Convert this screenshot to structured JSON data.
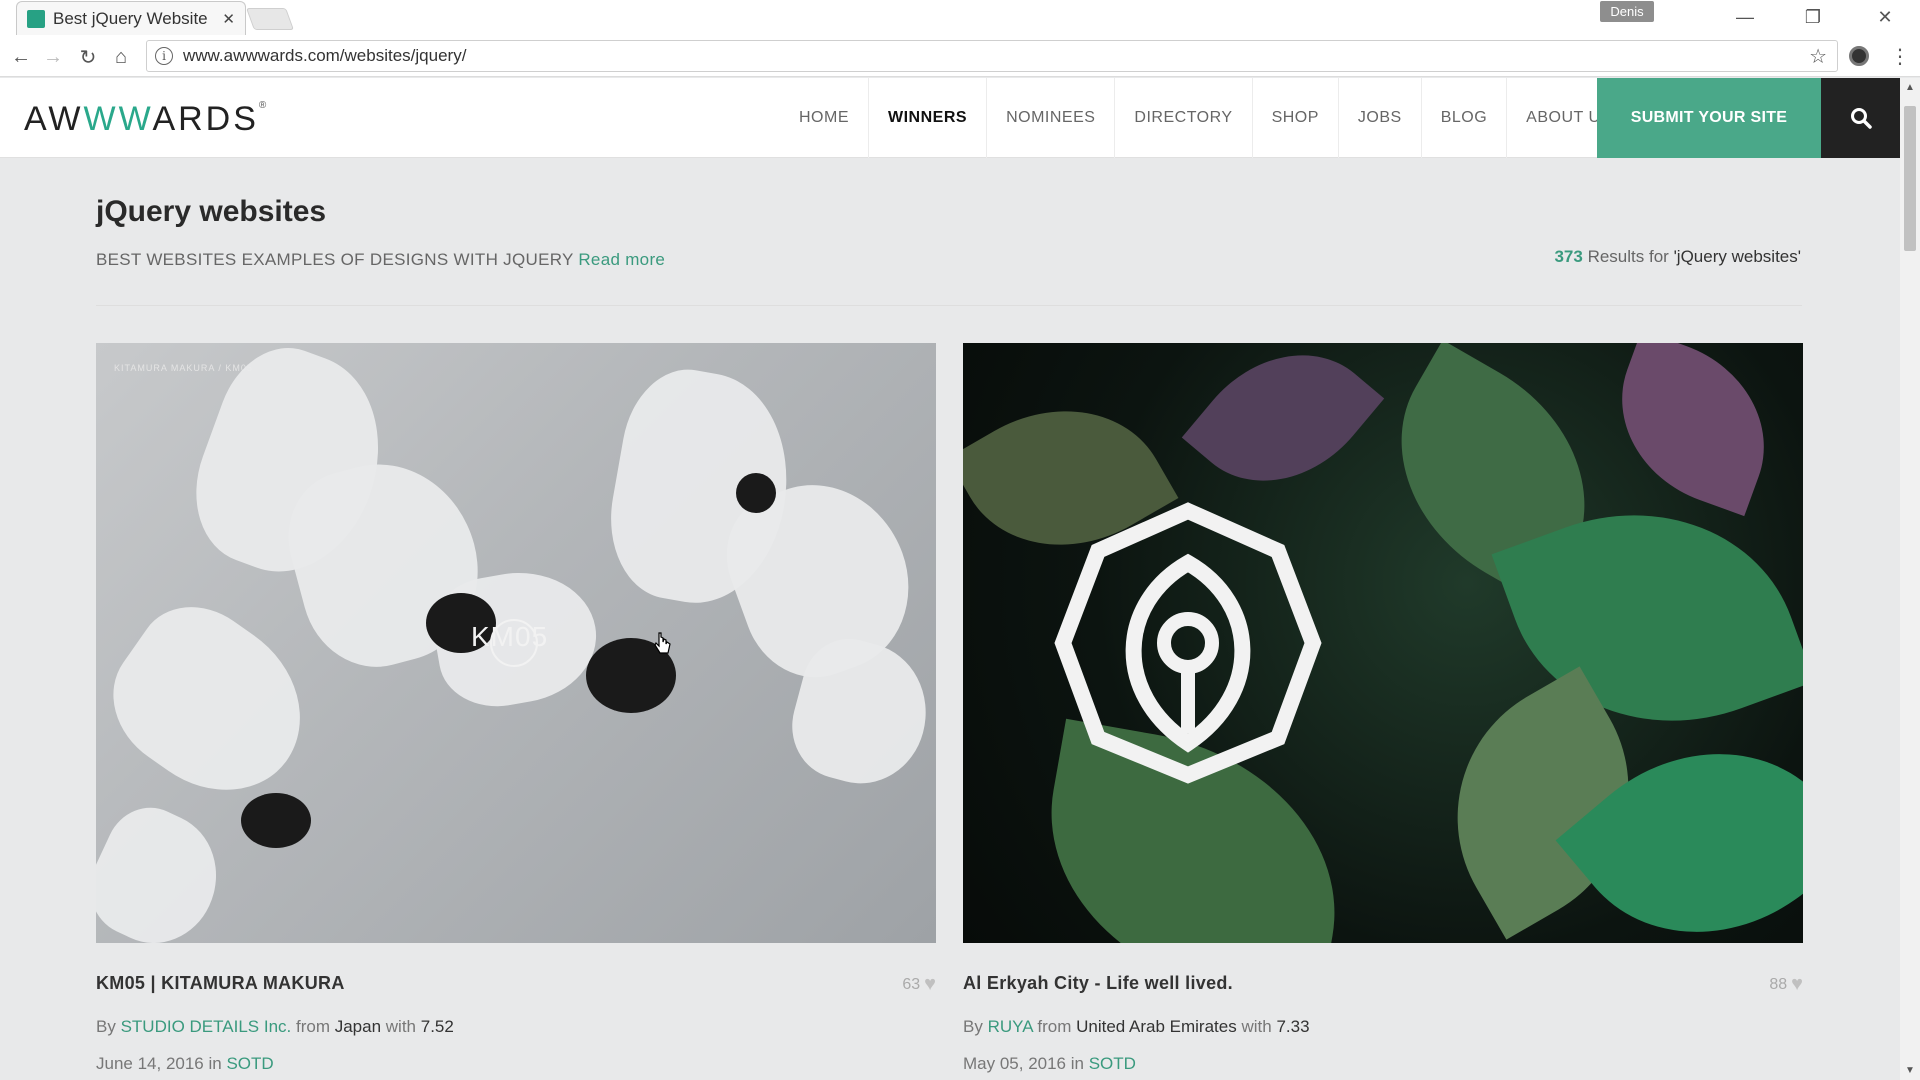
{
  "browser": {
    "tab_title": "Best jQuery Website",
    "profile_name": "Denis",
    "url": "www.awwwards.com/websites/jquery/"
  },
  "header": {
    "logo_left": "AW",
    "logo_mid": "WW",
    "logo_right": "ARDS",
    "logo_mark": "®",
    "nav": [
      {
        "label": "HOME"
      },
      {
        "label": "WINNERS"
      },
      {
        "label": "NOMINEES"
      },
      {
        "label": "DIRECTORY"
      },
      {
        "label": "SHOP"
      },
      {
        "label": "JOBS"
      },
      {
        "label": "BLOG"
      },
      {
        "label": "ABOUT US"
      }
    ],
    "active_nav": "WINNERS",
    "submit_label": "SUBMIT YOUR SITE"
  },
  "page": {
    "title": "jQuery websites",
    "subtitle": "BEST WEBSITES EXAMPLES OF DESIGNS WITH JQUERY",
    "read_more": "Read more",
    "results_count": "373",
    "results_text": "Results for",
    "results_query": "'jQuery websites'"
  },
  "cards": [
    {
      "title": "KM05 | KITAMURA MAKURA",
      "likes": "63",
      "by": "By",
      "author": "STUDIO DETAILS Inc.",
      "from": "from",
      "country": "Japan",
      "with": "with",
      "score": "7.52",
      "date": "June 14, 2016",
      "in": "in",
      "award": "SOTD",
      "image_overlay": "KM05",
      "image_label": "KITAMURA MAKURA / KM05"
    },
    {
      "title": "Al Erkyah City - Life well lived.",
      "likes": "88",
      "by": "By",
      "author": "RUYA",
      "from": "from",
      "country": "United Arab Emirates",
      "with": "with",
      "score": "7.33",
      "date": "May 05, 2016",
      "in": "in",
      "award": "SOTD"
    }
  ],
  "colors": {
    "accent": "#4aa889",
    "link": "#3a9a7e",
    "background": "#e8e9ea"
  }
}
